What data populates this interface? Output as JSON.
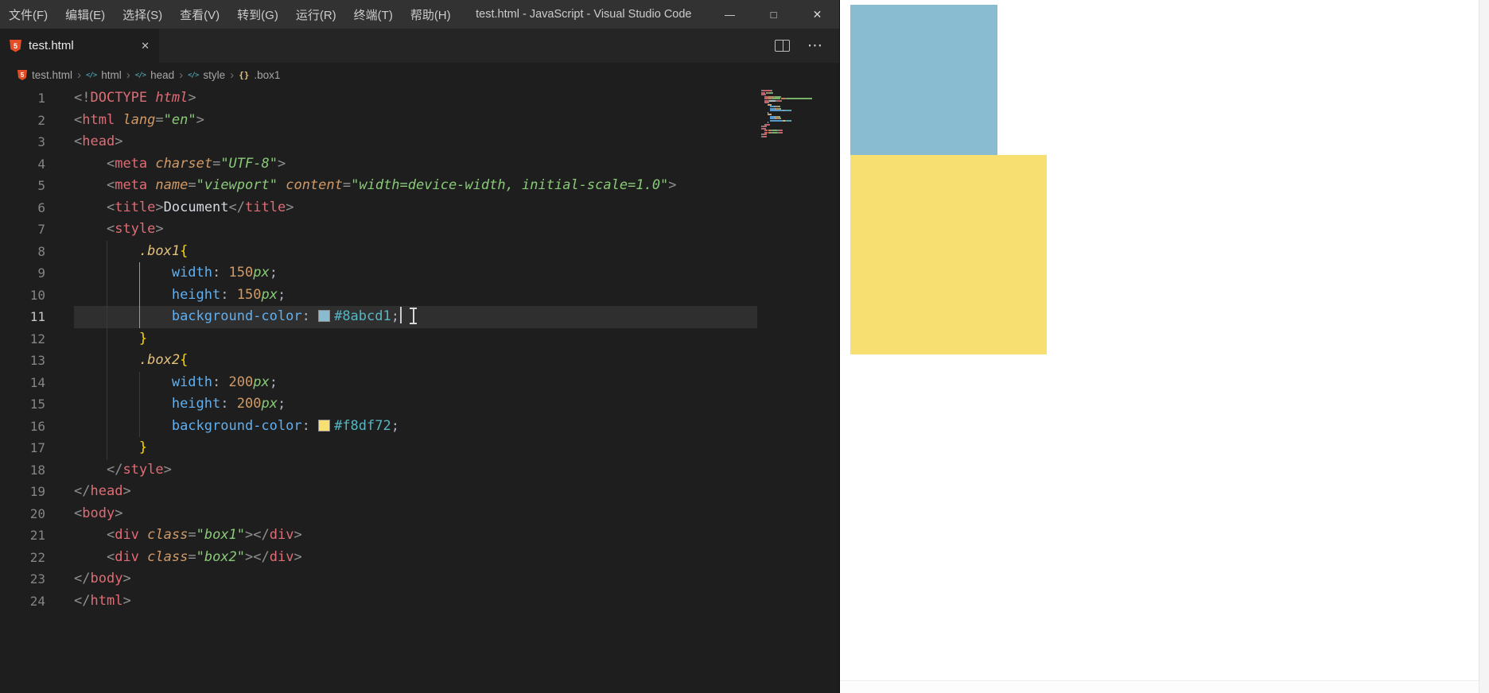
{
  "window": {
    "title": "test.html - JavaScript - Visual Studio Code",
    "menus": [
      "文件(F)",
      "编辑(E)",
      "选择(S)",
      "查看(V)",
      "转到(G)",
      "运行(R)",
      "终端(T)",
      "帮助(H)"
    ],
    "controls": {
      "minimize": "—",
      "maximize": "□",
      "close": "✕"
    }
  },
  "tab": {
    "label": "test.html",
    "close_glyph": "✕",
    "icon_text": "5"
  },
  "tabbar": {
    "more_glyph": "⋯"
  },
  "breadcrumb": {
    "separator": "›",
    "items": [
      {
        "label": "test.html",
        "icon": "html5"
      },
      {
        "label": "html",
        "icon": "code"
      },
      {
        "label": "head",
        "icon": "code"
      },
      {
        "label": "style",
        "icon": "code"
      },
      {
        "label": ".box1",
        "icon": "class"
      }
    ]
  },
  "icons": {
    "code_symbol": "</>",
    "css_class": "{}"
  },
  "editor": {
    "current_line": 11,
    "lines": [
      [
        {
          "t": "<!",
          "c": "pun"
        },
        {
          "t": "DOCTYPE ",
          "c": "tag"
        },
        {
          "t": "html",
          "c": "tagit"
        },
        {
          "t": ">",
          "c": "pun"
        }
      ],
      [
        {
          "t": "<",
          "c": "pun"
        },
        {
          "t": "html",
          "c": "tag"
        },
        {
          "t": " ",
          "c": "ws"
        },
        {
          "t": "lang",
          "c": "attr"
        },
        {
          "t": "=",
          "c": "pun"
        },
        {
          "t": "\"en\"",
          "c": "str"
        },
        {
          "t": ">",
          "c": "pun"
        }
      ],
      [
        {
          "t": "<",
          "c": "pun"
        },
        {
          "t": "head",
          "c": "tag"
        },
        {
          "t": ">",
          "c": "pun"
        }
      ],
      [
        {
          "t": "    ",
          "c": "ws"
        },
        {
          "t": "<",
          "c": "pun"
        },
        {
          "t": "meta",
          "c": "tag"
        },
        {
          "t": " ",
          "c": "ws"
        },
        {
          "t": "charset",
          "c": "attr"
        },
        {
          "t": "=",
          "c": "pun"
        },
        {
          "t": "\"UTF-8\"",
          "c": "str"
        },
        {
          "t": ">",
          "c": "pun"
        }
      ],
      [
        {
          "t": "    ",
          "c": "ws"
        },
        {
          "t": "<",
          "c": "pun"
        },
        {
          "t": "meta",
          "c": "tag"
        },
        {
          "t": " ",
          "c": "ws"
        },
        {
          "t": "name",
          "c": "attr"
        },
        {
          "t": "=",
          "c": "pun"
        },
        {
          "t": "\"viewport\"",
          "c": "str"
        },
        {
          "t": " ",
          "c": "ws"
        },
        {
          "t": "content",
          "c": "attr"
        },
        {
          "t": "=",
          "c": "pun"
        },
        {
          "t": "\"width=device-width, initial-scale=1.0\"",
          "c": "str"
        },
        {
          "t": ">",
          "c": "pun"
        }
      ],
      [
        {
          "t": "    ",
          "c": "ws"
        },
        {
          "t": "<",
          "c": "pun"
        },
        {
          "t": "title",
          "c": "tag"
        },
        {
          "t": ">",
          "c": "pun"
        },
        {
          "t": "Document",
          "c": "txt"
        },
        {
          "t": "</",
          "c": "pun"
        },
        {
          "t": "title",
          "c": "tag"
        },
        {
          "t": ">",
          "c": "pun"
        }
      ],
      [
        {
          "t": "    ",
          "c": "ws"
        },
        {
          "t": "<",
          "c": "pun"
        },
        {
          "t": "style",
          "c": "tag"
        },
        {
          "t": ">",
          "c": "pun"
        }
      ],
      [
        {
          "t": "        ",
          "c": "ws"
        },
        {
          "t": ".box1",
          "c": "sel"
        },
        {
          "t": "{",
          "c": "brace"
        }
      ],
      [
        {
          "t": "            ",
          "c": "ws"
        },
        {
          "t": "width",
          "c": "prop"
        },
        {
          "t": ": ",
          "c": "op"
        },
        {
          "t": "150",
          "c": "num"
        },
        {
          "t": "px",
          "c": "unit"
        },
        {
          "t": ";",
          "c": "op"
        }
      ],
      [
        {
          "t": "            ",
          "c": "ws"
        },
        {
          "t": "height",
          "c": "prop"
        },
        {
          "t": ": ",
          "c": "op"
        },
        {
          "t": "150",
          "c": "num"
        },
        {
          "t": "px",
          "c": "unit"
        },
        {
          "t": ";",
          "c": "op"
        }
      ],
      [
        {
          "t": "            ",
          "c": "ws"
        },
        {
          "t": "background-color",
          "c": "prop"
        },
        {
          "t": ": ",
          "c": "op"
        },
        {
          "t": "",
          "c": "swatch",
          "col": "#8abcd1"
        },
        {
          "t": "#8abcd1",
          "c": "hex"
        },
        {
          "t": ";",
          "c": "op"
        }
      ],
      [
        {
          "t": "        ",
          "c": "ws"
        },
        {
          "t": "}",
          "c": "brace"
        }
      ],
      [
        {
          "t": "        ",
          "c": "ws"
        },
        {
          "t": ".box2",
          "c": "sel"
        },
        {
          "t": "{",
          "c": "brace"
        }
      ],
      [
        {
          "t": "            ",
          "c": "ws"
        },
        {
          "t": "width",
          "c": "prop"
        },
        {
          "t": ": ",
          "c": "op"
        },
        {
          "t": "200",
          "c": "num"
        },
        {
          "t": "px",
          "c": "unit"
        },
        {
          "t": ";",
          "c": "op"
        }
      ],
      [
        {
          "t": "            ",
          "c": "ws"
        },
        {
          "t": "height",
          "c": "prop"
        },
        {
          "t": ": ",
          "c": "op"
        },
        {
          "t": "200",
          "c": "num"
        },
        {
          "t": "px",
          "c": "unit"
        },
        {
          "t": ";",
          "c": "op"
        }
      ],
      [
        {
          "t": "            ",
          "c": "ws"
        },
        {
          "t": "background-color",
          "c": "prop"
        },
        {
          "t": ": ",
          "c": "op"
        },
        {
          "t": "",
          "c": "swatch",
          "col": "#f8df72"
        },
        {
          "t": "#f8df72",
          "c": "hex"
        },
        {
          "t": ";",
          "c": "op"
        }
      ],
      [
        {
          "t": "        ",
          "c": "ws"
        },
        {
          "t": "}",
          "c": "brace"
        }
      ],
      [
        {
          "t": "    ",
          "c": "ws"
        },
        {
          "t": "</",
          "c": "pun"
        },
        {
          "t": "style",
          "c": "tag"
        },
        {
          "t": ">",
          "c": "pun"
        }
      ],
      [
        {
          "t": "</",
          "c": "pun"
        },
        {
          "t": "head",
          "c": "tag"
        },
        {
          "t": ">",
          "c": "pun"
        }
      ],
      [
        {
          "t": "<",
          "c": "pun"
        },
        {
          "t": "body",
          "c": "tag"
        },
        {
          "t": ">",
          "c": "pun"
        }
      ],
      [
        {
          "t": "    ",
          "c": "ws"
        },
        {
          "t": "<",
          "c": "pun"
        },
        {
          "t": "div",
          "c": "tag"
        },
        {
          "t": " ",
          "c": "ws"
        },
        {
          "t": "class",
          "c": "attr"
        },
        {
          "t": "=",
          "c": "pun"
        },
        {
          "t": "\"box1\"",
          "c": "str"
        },
        {
          "t": ">",
          "c": "pun"
        },
        {
          "t": "</",
          "c": "pun"
        },
        {
          "t": "div",
          "c": "tag"
        },
        {
          "t": ">",
          "c": "pun"
        }
      ],
      [
        {
          "t": "    ",
          "c": "ws"
        },
        {
          "t": "<",
          "c": "pun"
        },
        {
          "t": "div",
          "c": "tag"
        },
        {
          "t": " ",
          "c": "ws"
        },
        {
          "t": "class",
          "c": "attr"
        },
        {
          "t": "=",
          "c": "pun"
        },
        {
          "t": "\"box2\"",
          "c": "str"
        },
        {
          "t": ">",
          "c": "pun"
        },
        {
          "t": "</",
          "c": "pun"
        },
        {
          "t": "div",
          "c": "tag"
        },
        {
          "t": ">",
          "c": "pun"
        }
      ],
      [
        {
          "t": "</",
          "c": "pun"
        },
        {
          "t": "body",
          "c": "tag"
        },
        {
          "t": ">",
          "c": "pun"
        }
      ],
      [
        {
          "t": "</",
          "c": "pun"
        },
        {
          "t": "html",
          "c": "tag"
        },
        {
          "t": ">",
          "c": "pun"
        }
      ]
    ]
  },
  "syntax_colors": {
    "pun": "#909090",
    "tag": "#e06c75",
    "tagit": "#e06c75",
    "attr": "#d19a66",
    "str": "#89ca78",
    "txt": "#d4d8e0",
    "sel": "#e5c07b",
    "brace": "#ffd700",
    "prop": "#61afef",
    "op": "#abb2bf",
    "num": "#d19a66",
    "unit": "#89ca78",
    "hex": "#56b6c2"
  },
  "italics": [
    "attr",
    "str",
    "sel",
    "unit",
    "tagit"
  ],
  "preview": {
    "box1_color": "#8abcd1",
    "box2_color": "#f8df72"
  },
  "colors": {
    "titlebar_bg": "#323233",
    "tabbar_bg": "#252526",
    "editor_bg": "#1e1e1e",
    "current_line_bg": "#2f2f2f",
    "gutter_fg": "#858585",
    "menu_fg": "#cccccc",
    "breadcrumb_fg": "#a6a6a6",
    "preview_bg": "#ffffff"
  }
}
